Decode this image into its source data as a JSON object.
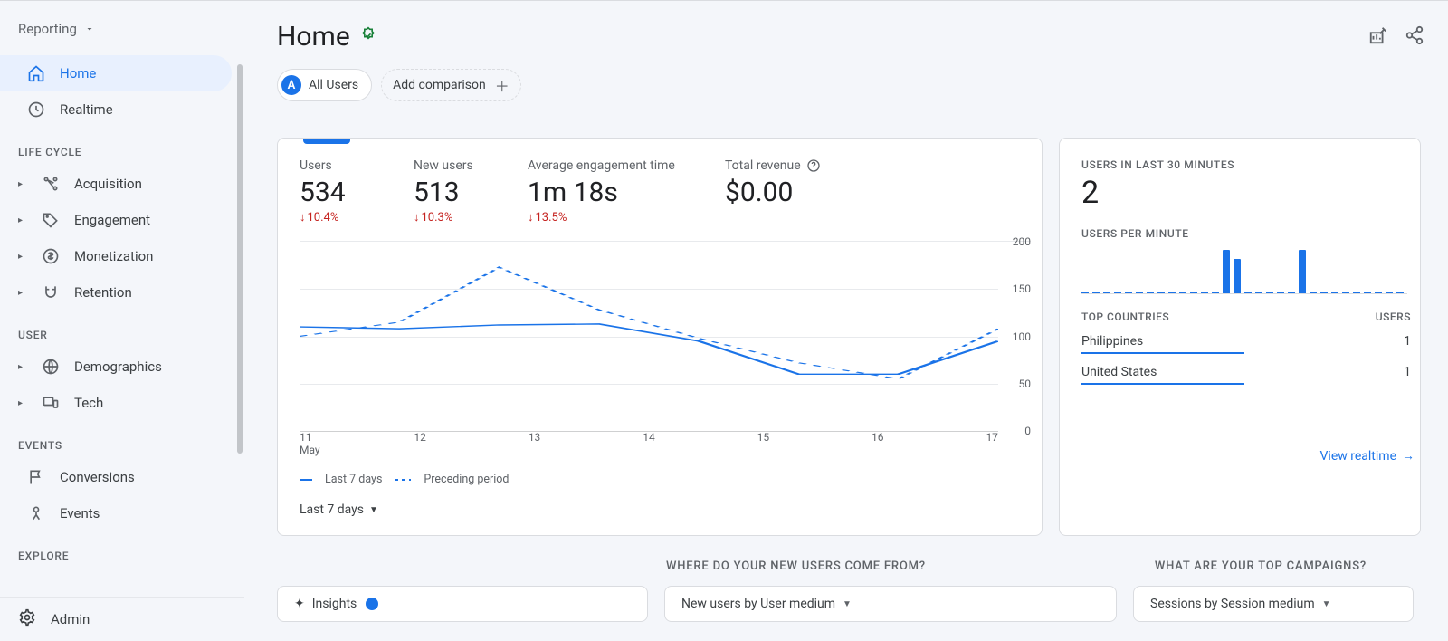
{
  "sidebar": {
    "reporting_label": "Reporting",
    "items_top": [
      {
        "label": "Home",
        "active": true,
        "icon": "home-icon"
      },
      {
        "label": "Realtime",
        "active": false,
        "icon": "clock-icon"
      }
    ],
    "sections": [
      {
        "title": "LIFE CYCLE",
        "items": [
          {
            "label": "Acquisition",
            "icon": "acquisition-icon"
          },
          {
            "label": "Engagement",
            "icon": "tag-icon"
          },
          {
            "label": "Monetization",
            "icon": "dollar-icon"
          },
          {
            "label": "Retention",
            "icon": "magnet-icon"
          }
        ]
      },
      {
        "title": "USER",
        "items": [
          {
            "label": "Demographics",
            "icon": "globe-icon"
          },
          {
            "label": "Tech",
            "icon": "devices-icon"
          }
        ]
      },
      {
        "title": "EVENTS",
        "items": [
          {
            "label": "Conversions",
            "icon": "flag-icon",
            "noexpand": true
          },
          {
            "label": "Events",
            "icon": "events-icon",
            "noexpand": true
          }
        ]
      },
      {
        "title": "EXPLORE",
        "items": []
      }
    ],
    "admin_label": "Admin"
  },
  "header": {
    "title": "Home"
  },
  "chips": {
    "all_users": "All Users",
    "add_comparison": "Add comparison"
  },
  "metrics": [
    {
      "label": "Users",
      "value": "534",
      "delta": "10.4%"
    },
    {
      "label": "New users",
      "value": "513",
      "delta": "10.3%"
    },
    {
      "label": "Average engagement time",
      "value": "1m 18s",
      "delta": "13.5%",
      "wide": true
    },
    {
      "label": "Total revenue",
      "value": "$0.00",
      "delta": null,
      "help": true,
      "rev": true
    }
  ],
  "chart_data": {
    "type": "line",
    "x": [
      "11",
      "12",
      "13",
      "14",
      "15",
      "16",
      "17"
    ],
    "x_sublabel": "May",
    "ylim": [
      0,
      200
    ],
    "yticks": [
      0,
      50,
      100,
      150,
      200
    ],
    "series": [
      {
        "name": "Last 7 days",
        "style": "solid",
        "values": [
          110,
          108,
          112,
          113,
          95,
          60,
          60,
          95
        ]
      },
      {
        "name": "Preceding period",
        "style": "dashed",
        "values": [
          100,
          115,
          173,
          128,
          98,
          72,
          55,
          108
        ]
      }
    ]
  },
  "period_selector": "Last 7 days",
  "legend": {
    "a": "Last 7 days",
    "b": "Preceding period"
  },
  "realtime": {
    "head1": "USERS IN LAST 30 MINUTES",
    "value": "2",
    "head2": "USERS PER MINUTE",
    "bars": [
      0,
      0,
      0,
      0,
      0,
      0,
      0,
      0,
      0,
      0,
      0,
      0,
      0,
      48,
      38,
      0,
      0,
      0,
      0,
      0,
      48,
      0,
      0,
      0,
      0,
      0,
      0,
      0,
      0,
      0
    ],
    "countries_head": "TOP COUNTRIES",
    "users_head": "USERS",
    "countries": [
      {
        "name": "Philippines",
        "users": "1",
        "pct": 100
      },
      {
        "name": "United States",
        "users": "1",
        "pct": 100
      }
    ],
    "view_link": "View realtime"
  },
  "bottom": {
    "q1": "WHERE DO YOUR NEW USERS COME FROM?",
    "q2": "WHAT ARE YOUR TOP CAMPAIGNS?",
    "insights": "Insights",
    "newusers": "New users by User medium",
    "sessions": "Sessions  by Session medium"
  }
}
